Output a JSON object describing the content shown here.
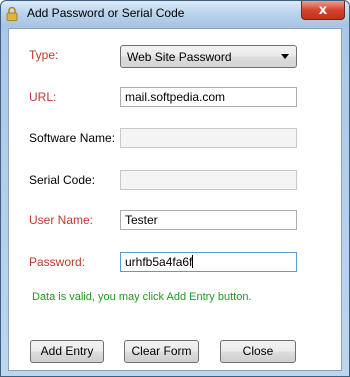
{
  "window": {
    "title": "Add Password or Serial Code",
    "close_glyph": "x"
  },
  "form": {
    "type_label": "Type:",
    "type_value": "Web Site Password",
    "url_label": "URL:",
    "url_value": "mail.softpedia.com",
    "software_label": "Software Name:",
    "software_value": "",
    "serial_label": "Serial Code:",
    "serial_value": "",
    "user_label": "User Name:",
    "user_value": "Tester",
    "password_label": "Password:",
    "password_value": "urhfb5a4fa6f"
  },
  "status": {
    "text": "Data is valid, you may click Add Entry button."
  },
  "buttons": {
    "add_entry": "Add Entry",
    "clear_form": "Clear Form",
    "close": "Close"
  },
  "colors": {
    "required_label": "#c0392b",
    "status_text": "#1f9a1f"
  },
  "icons": {
    "app": "lock-icon",
    "close": "close-icon",
    "dropdown": "chevron-down-icon"
  }
}
